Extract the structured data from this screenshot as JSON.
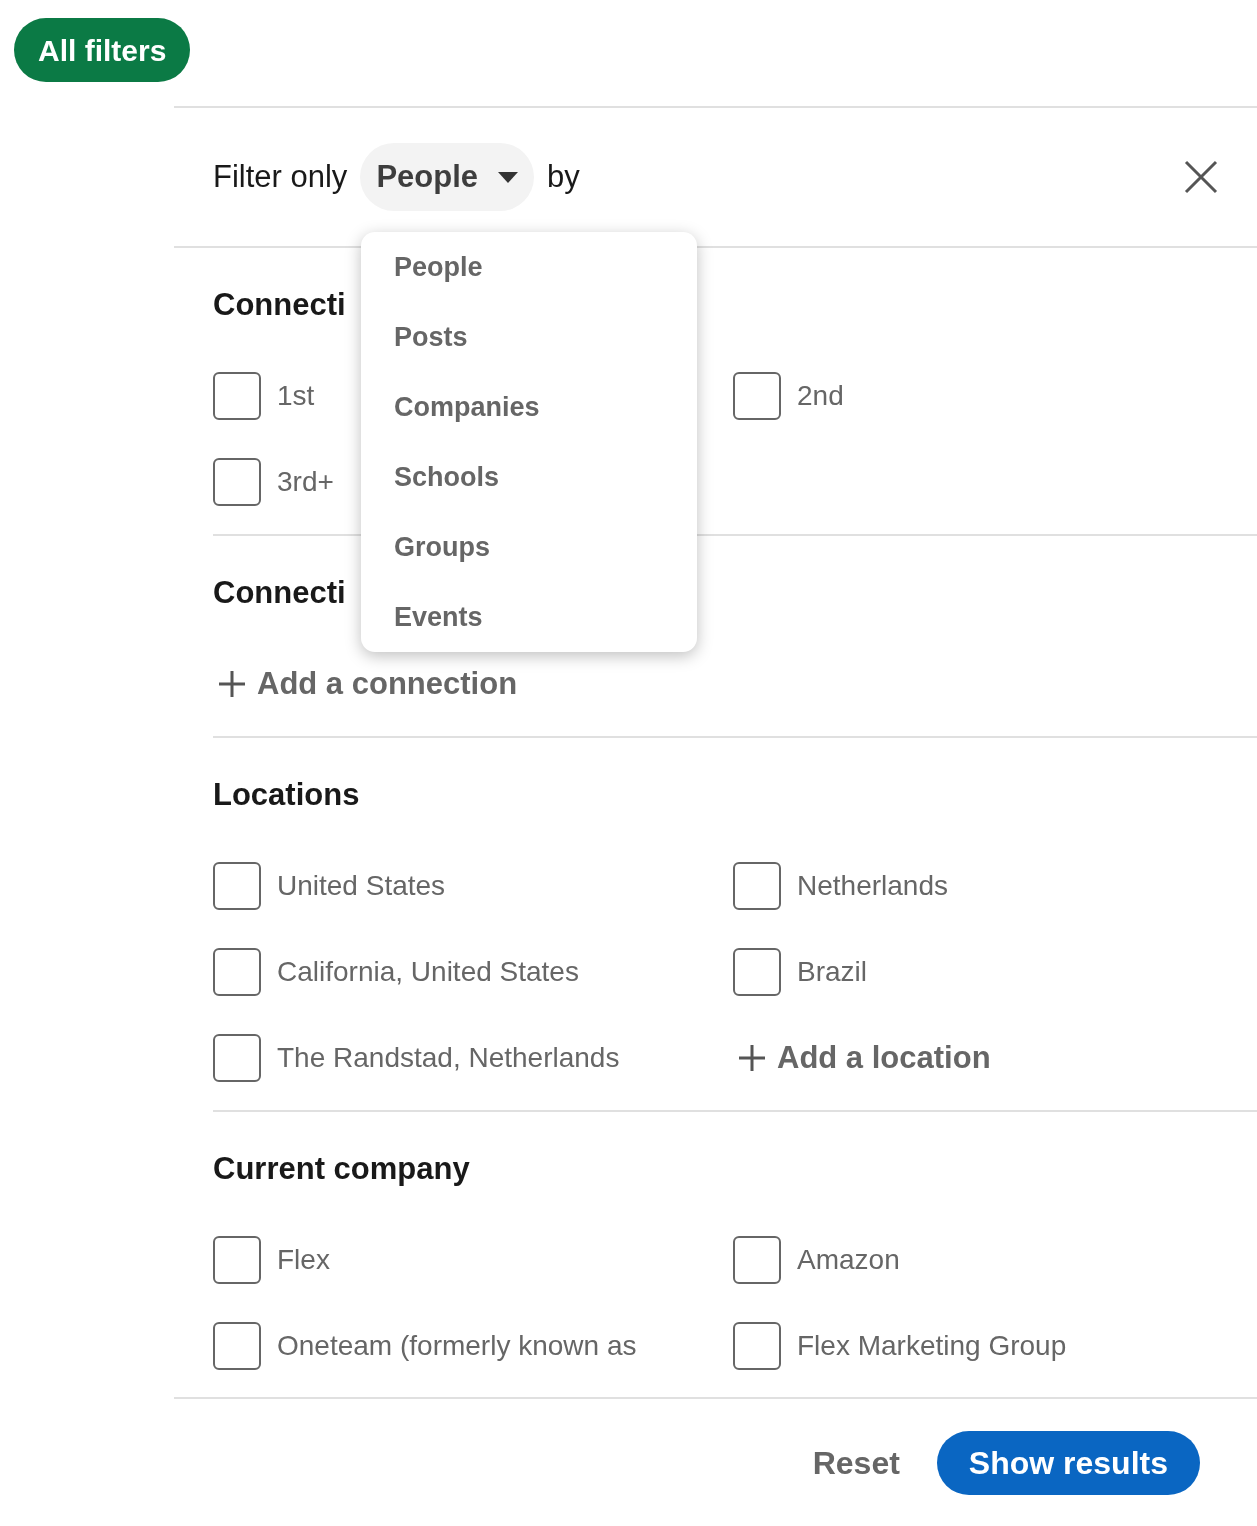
{
  "all_filters_button": "All filters",
  "filter_bar": {
    "prefix": "Filter only",
    "type_dropdown": {
      "value": "People",
      "expanded": true
    },
    "suffix": "by"
  },
  "dropdown_menu": {
    "items": [
      "People",
      "Posts",
      "Companies",
      "Schools",
      "Groups",
      "Events"
    ]
  },
  "sections": [
    {
      "heading": "Connecti",
      "items": [
        {
          "kind": "checkbox",
          "label": "1st",
          "checked": false
        },
        {
          "kind": "checkbox",
          "label": "2nd",
          "checked": false
        },
        {
          "kind": "checkbox",
          "label": "3rd+",
          "checked": false
        }
      ]
    },
    {
      "heading": "Connecti",
      "items": [
        {
          "kind": "add",
          "label": "Add a connection"
        }
      ]
    },
    {
      "heading": "Locations",
      "items": [
        {
          "kind": "checkbox",
          "label": "United States",
          "checked": false
        },
        {
          "kind": "checkbox",
          "label": "Netherlands",
          "checked": false
        },
        {
          "kind": "checkbox",
          "label": "California, United States",
          "checked": false
        },
        {
          "kind": "checkbox",
          "label": "Brazil",
          "checked": false
        },
        {
          "kind": "checkbox",
          "label": "The Randstad, Netherlands",
          "checked": false
        },
        {
          "kind": "add",
          "label": "Add a location"
        }
      ]
    },
    {
      "heading": "Current company",
      "items": [
        {
          "kind": "checkbox",
          "label": "Flex",
          "checked": false
        },
        {
          "kind": "checkbox",
          "label": "Amazon",
          "checked": false
        },
        {
          "kind": "checkbox",
          "label": "Oneteam (formerly known as",
          "checked": false
        },
        {
          "kind": "checkbox",
          "label": "Flex Marketing Group",
          "checked": false
        }
      ]
    }
  ],
  "footer": {
    "reset_button": "Reset",
    "show_results_button": "Show results"
  }
}
